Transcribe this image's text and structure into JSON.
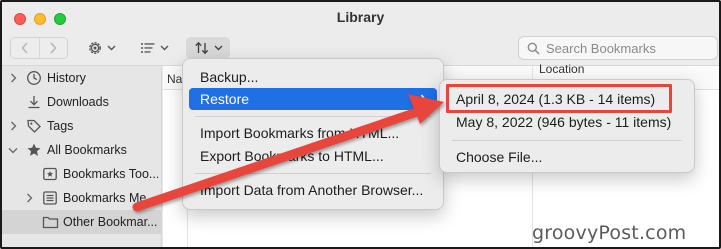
{
  "window": {
    "title": "Library"
  },
  "toolbar": {
    "search_placeholder": "Search Bookmarks"
  },
  "sidebar": {
    "items": [
      {
        "label": "History",
        "icon": "clock-icon",
        "expandable": true
      },
      {
        "label": "Downloads",
        "icon": "download-icon",
        "expandable": false
      },
      {
        "label": "Tags",
        "icon": "tag-icon",
        "expandable": true
      },
      {
        "label": "All Bookmarks",
        "icon": "star-icon",
        "expandable": true,
        "expanded": true
      },
      {
        "label": "Bookmarks Too...",
        "icon": "bookmarks-toolbar-icon",
        "expandable": false
      },
      {
        "label": "Bookmarks Me...",
        "icon": "bookmarks-menu-icon",
        "expandable": true
      },
      {
        "label": "Other Bookmar...",
        "icon": "folder-icon",
        "expandable": false,
        "selected": true
      }
    ]
  },
  "columns": {
    "name": "Nar",
    "location": "Location"
  },
  "import_menu": {
    "items": [
      {
        "label": "Backup..."
      },
      {
        "label": "Restore",
        "active": true,
        "submenu": true
      },
      {
        "label": "Import Bookmarks from HTML..."
      },
      {
        "label": "Export Bookmarks to HTML..."
      },
      {
        "label": "Import Data from Another Browser..."
      }
    ]
  },
  "restore_submenu": {
    "items": [
      {
        "label": "April 8, 2024 (1.3 KB - 14 items)",
        "highlighted": true
      },
      {
        "label": "May 8, 2022 (946 bytes - 11 items)"
      },
      {
        "label": "Choose File..."
      }
    ]
  },
  "watermark": "groovyPost.com",
  "colors": {
    "accent": "#1f6fe5",
    "annotation": "#e8453c"
  }
}
